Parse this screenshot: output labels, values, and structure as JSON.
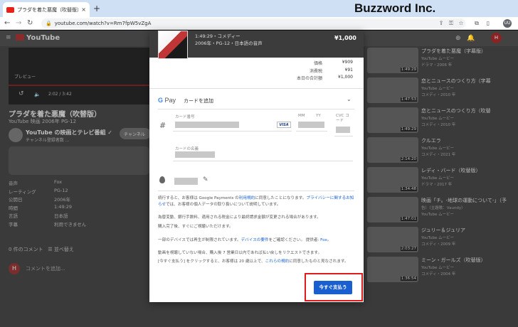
{
  "browser": {
    "tab_title": "プラダを着た悪魔（吹替版） - Yo",
    "tab_close": "×",
    "new_tab": "+",
    "url": "youtube.com/watch?v=Rm7fpW5vZgA",
    "watermark": "Buzzword Inc.",
    "profile_initial": "UU",
    "toolbar_icons": [
      "share-icon",
      "key-icon",
      "star-icon",
      "puzzle-icon",
      "sidebar-icon"
    ]
  },
  "youtube": {
    "logo_text": "YouTube",
    "avatar_initial": "H",
    "player_time": "2:02 / 3:42",
    "player_preview": "プレビュー",
    "video_title": "プラダを着た悪魔（吹替版）",
    "video_meta": "YouTube 映画 2006年 PG-12",
    "channel_name": "YouTube の映画とテレビ番組 ✓",
    "channel_sub": "チャンネル登録者数 ...",
    "channel_button": "チャンネル",
    "info_rows": [
      {
        "k": "音声",
        "v": "Fox"
      },
      {
        "k": "レーティング",
        "v": "PG-12"
      },
      {
        "k": "公開日",
        "v": "2006年"
      },
      {
        "k": "時間",
        "v": "1:49:29"
      },
      {
        "k": "言語",
        "v": "日本語"
      },
      {
        "k": "字幕",
        "v": "利用できません"
      }
    ],
    "comments_count": "0 件のコメント",
    "sort_label": "並べ替え",
    "comment_placeholder": "コメントを追加...",
    "related": [
      {
        "title": "プラダを着た悪魔（字幕版）",
        "sub1": "YouTube ムービー",
        "sub2": "ドラマ・2006 年",
        "dur": "1:49:29"
      },
      {
        "title": "恋とニュースのつくり方（字幕",
        "sub1": "YouTube ムービー",
        "sub2": "コメディ・2010 年",
        "dur": "1:47:53"
      },
      {
        "title": "恋とニュースのつくり方（吹替",
        "sub1": "YouTube ムービー",
        "sub2": "コメディ・2010 年",
        "dur": "1:49:29"
      },
      {
        "title": "クルエラ",
        "sub1": "YouTube ムービー",
        "sub2": "コメディ・2021 年",
        "dur": "2:14:20"
      },
      {
        "title": "レディ・バード（吹替版）",
        "sub1": "YouTube ムービー",
        "sub2": "ドラマ・2017 年",
        "dur": "1:34:48"
      },
      {
        "title": "映画「チ。-地球の運動について-」（予",
        "sub1": "告）（主題歌：Vaundy）",
        "sub2": "YouTube ムービー",
        "dur": "1:47:01"
      },
      {
        "title": "ジュリー＆ジュリア",
        "sub1": "YouTube ムービー",
        "sub2": "コメディ・2009 年",
        "dur": "2:03:27"
      },
      {
        "title": "ミーン・ガールズ（吹替版）",
        "sub1": "YouTube ムービー",
        "sub2": "コメディ・2004 年",
        "dur": "1:36:54"
      }
    ]
  },
  "dialog": {
    "header_line1": "1:49:29・コメディー",
    "header_line2": "2006年・PG-12・日本語の音声",
    "header_price": "¥1,000",
    "costs": [
      {
        "label": "価格",
        "value": "¥909"
      },
      {
        "label": "消費税",
        "value": "¥91"
      },
      {
        "label": "本日の合計額",
        "value": "¥1,000"
      }
    ],
    "gpay_g": "G",
    "gpay_pay": " Pay",
    "add_card": "カードを追加",
    "chevron": "⌄",
    "card_number_label": "カード番号",
    "mm_label": "MM",
    "yy_label": "YY",
    "cvc_label": "CVC コード",
    "visa": "VISA",
    "name_label": "カードの名義",
    "hash": "#",
    "legal": {
      "p1_a": "続行すると、お客様は Google Payments の",
      "p1_link1": "利用規約",
      "p1_b": "に同意したことになります。",
      "p1_link2": "プライバシーに関するお知らせ",
      "p1_c": "では、お客様の個人データの取り扱いについて説明しています。",
      "p2": "為替変動、銀行手数料、適用される税金により最終請求金額が変更される場合があります。",
      "p3": "購入完了後、すぐにご視聴いただけます。",
      "p4_a": "一部のデバイスでは再生が制限されています。",
      "p4_link": "デバイスの要件",
      "p4_b": "をご確認ください。 提供者: ",
      "p4_link2": "Fox",
      "p4_c": "。",
      "p5": "動画を視聴していない場合、購入後 7 営業日以内であれば払い戻しをリクエストできます。",
      "p6_a": "[今すぐ支払う] をクリックすると、お客様は 20 歳以上で、",
      "p6_link": "これらの規約",
      "p6_b": "に同意したものと見なされます。"
    },
    "pay_button": "今すぐ支払う"
  }
}
